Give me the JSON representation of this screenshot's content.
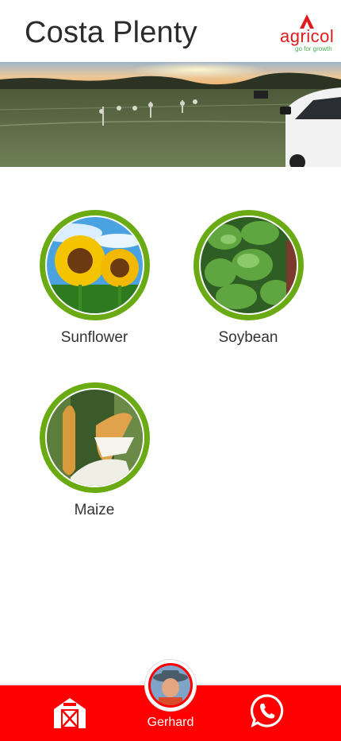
{
  "header": {
    "title": "Costa Plenty",
    "logo": {
      "word": "agricol",
      "tagline": "go for growth",
      "color": "#e01b1b",
      "tagline_color": "#4caf50"
    }
  },
  "crops": [
    {
      "label": "Sunflower",
      "image": "sunflower-photo"
    },
    {
      "label": "Soybean",
      "image": "soybean-photo"
    },
    {
      "label": "Maize",
      "image": "maize-photo"
    }
  ],
  "bottom_nav": {
    "profile_name": "Gerhard",
    "accent": "#ff0000",
    "icons": [
      "farm-icon",
      "whatsapp-icon"
    ]
  }
}
